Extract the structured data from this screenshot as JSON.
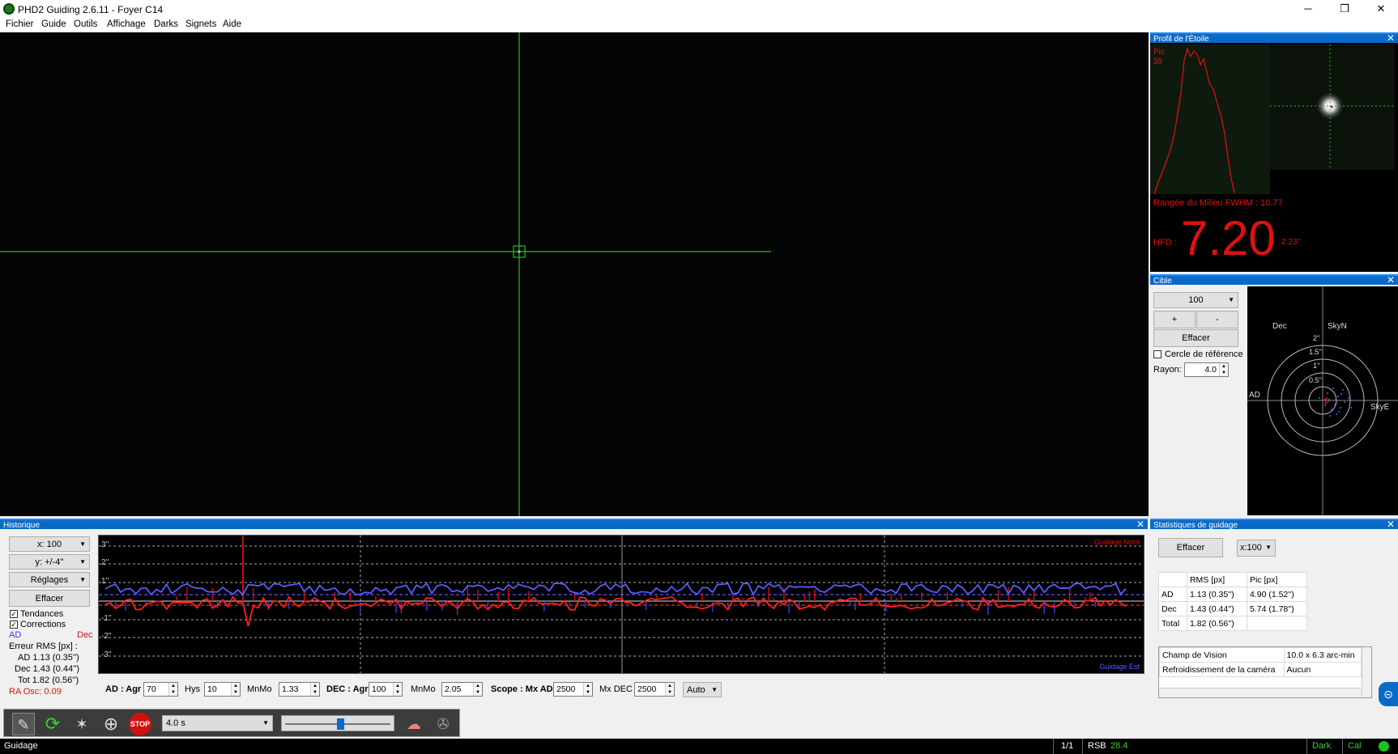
{
  "window": {
    "title": "PHD2 Guiding 2.6.11 - Foyer C14",
    "min_glyph": "─",
    "max_glyph": "❐",
    "close_glyph": "✕"
  },
  "menu": [
    "Fichier",
    "Guide",
    "Outils",
    "Affichage",
    "Darks",
    "Signets",
    "Aide"
  ],
  "profile": {
    "title": "Profil de l'Étoile",
    "peak_label": "Pic",
    "peak_value": "39",
    "fwhm_text": "Rangée du Milieu FWHM : 10.77",
    "hfd_label": "HFD :",
    "hfd_value": "7.20",
    "hfd_arcsec": "2.23''"
  },
  "target": {
    "title": "Cible",
    "zoom_value": "100",
    "plus_label": "+",
    "minus_label": "-",
    "clear_label": "Effacer",
    "ref_circle_label": "Cercle de référence",
    "radius_label": "Rayon:",
    "radius_value": "4.0",
    "labels": {
      "dec": "Dec",
      "skyn": "SkyN",
      "ad": "AD",
      "skye": "SkyE",
      "r2": "2''",
      "r15": "1.5''",
      "r1": "1''",
      "r05": "0.5''"
    }
  },
  "history": {
    "title": "Historique",
    "x_scale": "x: 100",
    "y_scale": "y: +/-4''",
    "settings_label": "Réglages",
    "clear_label": "Effacer",
    "trends_label": "Tendances",
    "corrections_label": "Corrections",
    "legend_ad": "AD",
    "legend_dec": "Dec",
    "rms_header": "Erreur RMS [px] :",
    "rms_ad": "AD 1.13 (0.35'')",
    "rms_dec": "Dec 1.43 (0.44'')",
    "rms_tot": "Tot 1.82 (0.56'')",
    "ra_osc": "RA Osc: 0.09",
    "guide_north": "Guidage Nord",
    "guide_east": "Guidage Est",
    "y_ticks": [
      "3''",
      "2''",
      "1''",
      "-1''",
      "-2''",
      "-3''"
    ],
    "controls": {
      "ad_label": "AD : Agr",
      "ad_agr": "70",
      "hys_label": "Hys",
      "hys": "10",
      "mnmo_label": "MnMo",
      "ad_mnmo": "1.33",
      "dec_label": "DEC : Agr",
      "dec_agr": "100",
      "dec_mnmo_label": "MnMo",
      "dec_mnmo": "2.05",
      "scope_label": "Scope : Mx AD",
      "mx_ad": "2500",
      "mx_dec_label": "Mx DEC",
      "mx_dec": "2500",
      "mode": "Auto"
    }
  },
  "stats": {
    "title": "Statistiques de guidage",
    "clear_label": "Effacer",
    "x_scale": "x:100",
    "headers": [
      "",
      "RMS [px]",
      "Pic [px]"
    ],
    "rows": [
      [
        "AD",
        "1.13 (0.35'')",
        "4.90 (1.52'')"
      ],
      [
        "Dec",
        "1.43 (0.44'')",
        "5.74 (1.78'')"
      ],
      [
        "Total",
        "1.82 (0.56'')",
        ""
      ]
    ],
    "info_rows": [
      [
        "Champ de Vision",
        "10.0 x  6.3  arc-min"
      ],
      [
        "Refroidissement de la caméra",
        "Aucun"
      ]
    ]
  },
  "toolbar": {
    "exposure": "4.0 s",
    "stop_label": "STOP"
  },
  "status": {
    "left": "Guidage",
    "frame": "1/1",
    "snr_label": "RSB",
    "snr_value": "28.4",
    "dark": "Dark",
    "cal": "Cal"
  },
  "colors": {
    "accent": "#0a6ac8",
    "ra": "#5a5aff",
    "dec": "#ff2020",
    "crosshair": "#20c020"
  }
}
